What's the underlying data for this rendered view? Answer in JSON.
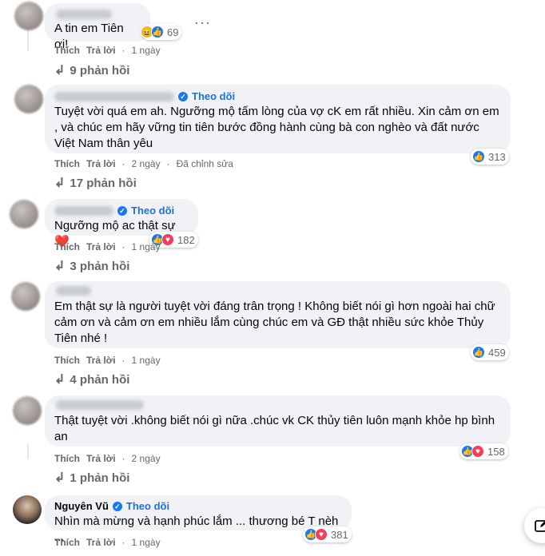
{
  "comments": [
    {
      "name": "",
      "follow_label": "",
      "text": "A tin em Tiên ơi!",
      "reactions": [
        "haha",
        "like"
      ],
      "reaction_count": "69",
      "like_label": "Thích",
      "reply_label": "Trả lời",
      "time": "1 ngày",
      "edited": "",
      "replies_label": "9 phản hồi"
    },
    {
      "name": "",
      "follow_label": "Theo dõi",
      "text": "Tuyệt vời quá em ah. Ngưỡng mộ tấm lòng của vợ cK em rất nhiều. Xin cảm ơn em , và chúc em hãy vững tin tiên bước đồng hành cùng bà con nghèo và đất nước Việt Nam thân yêu",
      "reactions": [
        "like"
      ],
      "reaction_count": "313",
      "like_label": "Thích",
      "reply_label": "Trả lời",
      "time": "2 ngày",
      "edited": "Đã chỉnh sửa",
      "replies_label": "17 phản hồi"
    },
    {
      "name": "",
      "follow_label": "Theo dõi",
      "text": "Ngưỡng mộ ac thật sự ❤️",
      "reactions": [
        "like",
        "love"
      ],
      "reaction_count": "182",
      "like_label": "Thích",
      "reply_label": "Trả lời",
      "time": "1 ngày",
      "edited": "",
      "replies_label": "3 phản hồi"
    },
    {
      "name": "",
      "follow_label": "",
      "text": "Em thật sự là người tuyệt vời đáng trân trọng ! Không biết nói gì hơn ngoài hai chữ cảm ơn và cảm ơn em nhiều lắm cùng chúc em và GĐ thật nhiều sức khỏe Thủy Tiên nhé !",
      "reactions": [
        "like"
      ],
      "reaction_count": "459",
      "like_label": "Thích",
      "reply_label": "Trả lời",
      "time": "1 ngày",
      "edited": "",
      "replies_label": "4 phản hồi"
    },
    {
      "name": "",
      "follow_label": "",
      "text": "Thật tuyệt vời .không biết nói gì nữa .chúc vk CK thủy tiên luôn mạnh khỏe hp bình an",
      "reactions": [
        "like",
        "love"
      ],
      "reaction_count": "158",
      "like_label": "Thích",
      "reply_label": "Trả lời",
      "time": "2 ngày",
      "edited": "",
      "replies_label": "1 phản hồi"
    },
    {
      "name": "Nguyên Vũ",
      "follow_label": "Theo dõi",
      "text": "Nhìn mà mừng và hạnh phúc lắm ... thương bé T nèh ...",
      "reactions": [
        "like",
        "love"
      ],
      "reaction_count": "381",
      "like_label": "Thích",
      "reply_label": "Trả lời",
      "time": "1 ngày",
      "edited": "",
      "replies_label": ""
    }
  ],
  "more_label": "···",
  "colors": {
    "bubble": "#f0f2f5",
    "link": "#216fdb",
    "muted": "#65676b",
    "like": "#1877f2",
    "love": "#f33e58"
  }
}
